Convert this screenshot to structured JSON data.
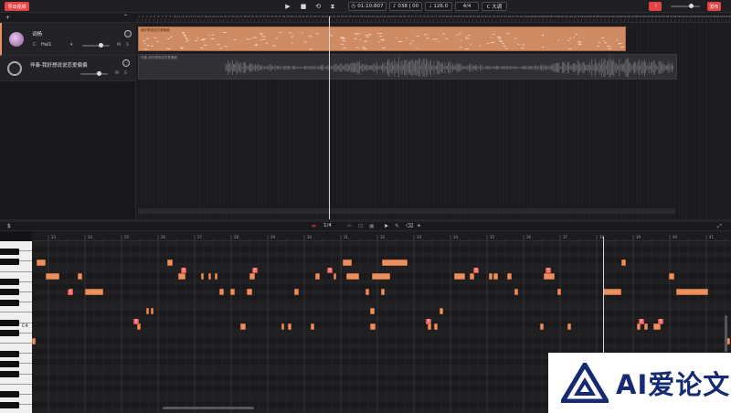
{
  "topbar": {
    "export_label": "导出视频",
    "time": "01:10:807",
    "bar_position": "038 | 00",
    "tempo": "126.0",
    "time_signature": "4/4",
    "key": "C 大调",
    "publish_label": "发布"
  },
  "tracks": [
    {
      "name": "词杨",
      "instrument": "Hal1",
      "type": "vocal"
    },
    {
      "name": "伴奏-我好想说说恋爱偏偏",
      "type": "accompaniment"
    }
  ],
  "clips": {
    "vocal_clip_label": "我好想说说恋爱偏偏",
    "audio_clip_label": "伴奏-我好想说说恋爱偏偏"
  },
  "ruler_top_start": 1,
  "piano_roll": {
    "quantize": "1/4",
    "ruler_labels": [
      "23",
      "24",
      "25",
      "26",
      "27",
      "28",
      "29",
      "30",
      "31",
      "32",
      "33",
      "34",
      "35",
      "36",
      "37",
      "38",
      "39",
      "40",
      "41"
    ],
    "c4_label": "C4",
    "markers_label": "音"
  },
  "watermark": {
    "text": "AI爱论文"
  },
  "colors": {
    "accent": "#e9905e",
    "red": "#e64444",
    "brand_blue": "#152a72"
  }
}
